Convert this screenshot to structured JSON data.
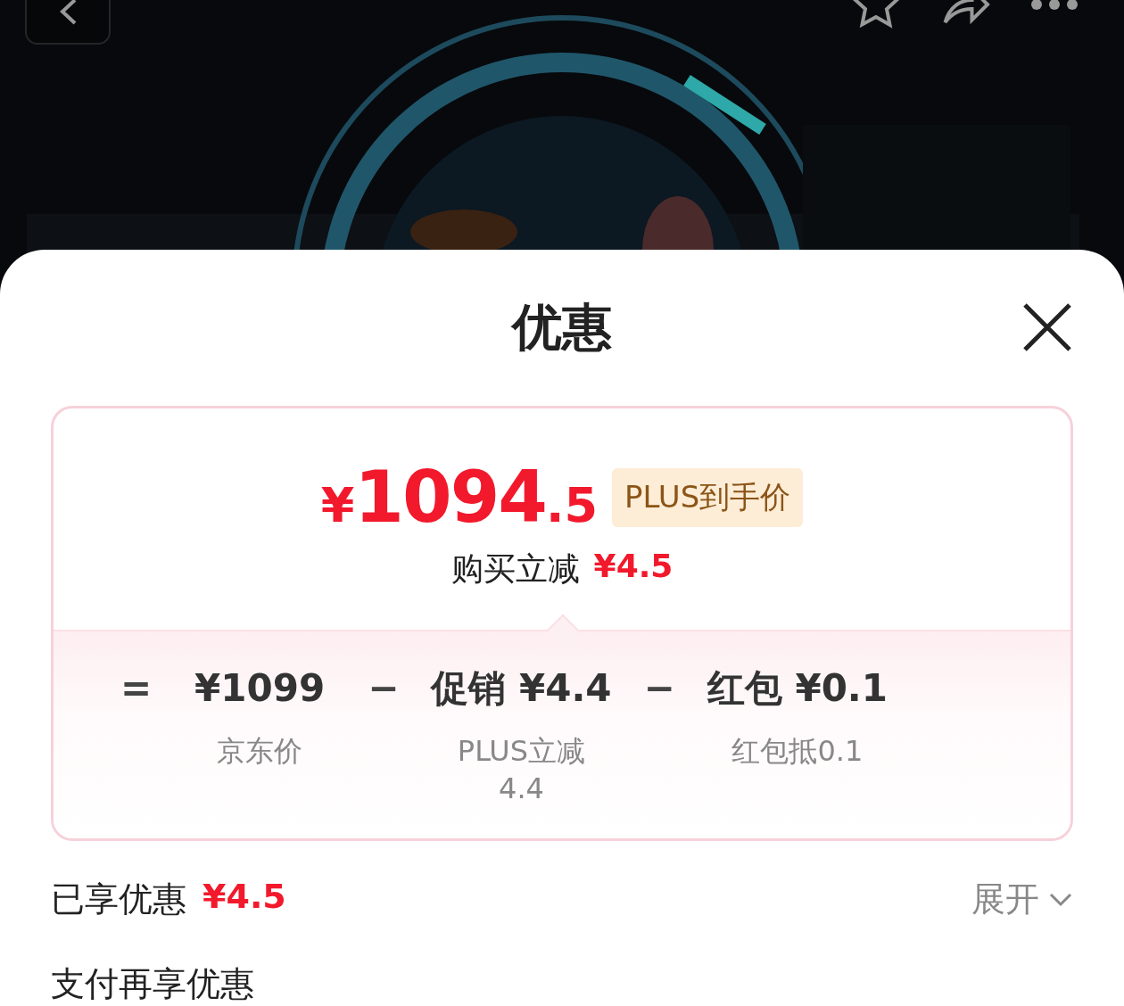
{
  "sheet": {
    "title": "优惠",
    "price": {
      "currency": "¥",
      "integer": "1094",
      "fraction": ".5",
      "badge": "PLUS到手价"
    },
    "instant_discount": {
      "label": "购买立减",
      "amount": "¥4.5"
    },
    "breakdown": [
      {
        "kind": "operator",
        "text": "="
      },
      {
        "kind": "term",
        "text": "¥1099",
        "note": "京东价"
      },
      {
        "kind": "operator",
        "text": "−"
      },
      {
        "kind": "term",
        "text": "促销 ¥4.4",
        "note": "PLUS立减4.4"
      },
      {
        "kind": "operator",
        "text": "−"
      },
      {
        "kind": "term",
        "text": "红包 ¥0.1",
        "note": "红包抵0.1"
      }
    ],
    "enjoyed": {
      "label": "已享优惠",
      "amount": "¥4.5",
      "toggle": "展开",
      "expanded": false
    },
    "more": "支付再享优惠"
  }
}
